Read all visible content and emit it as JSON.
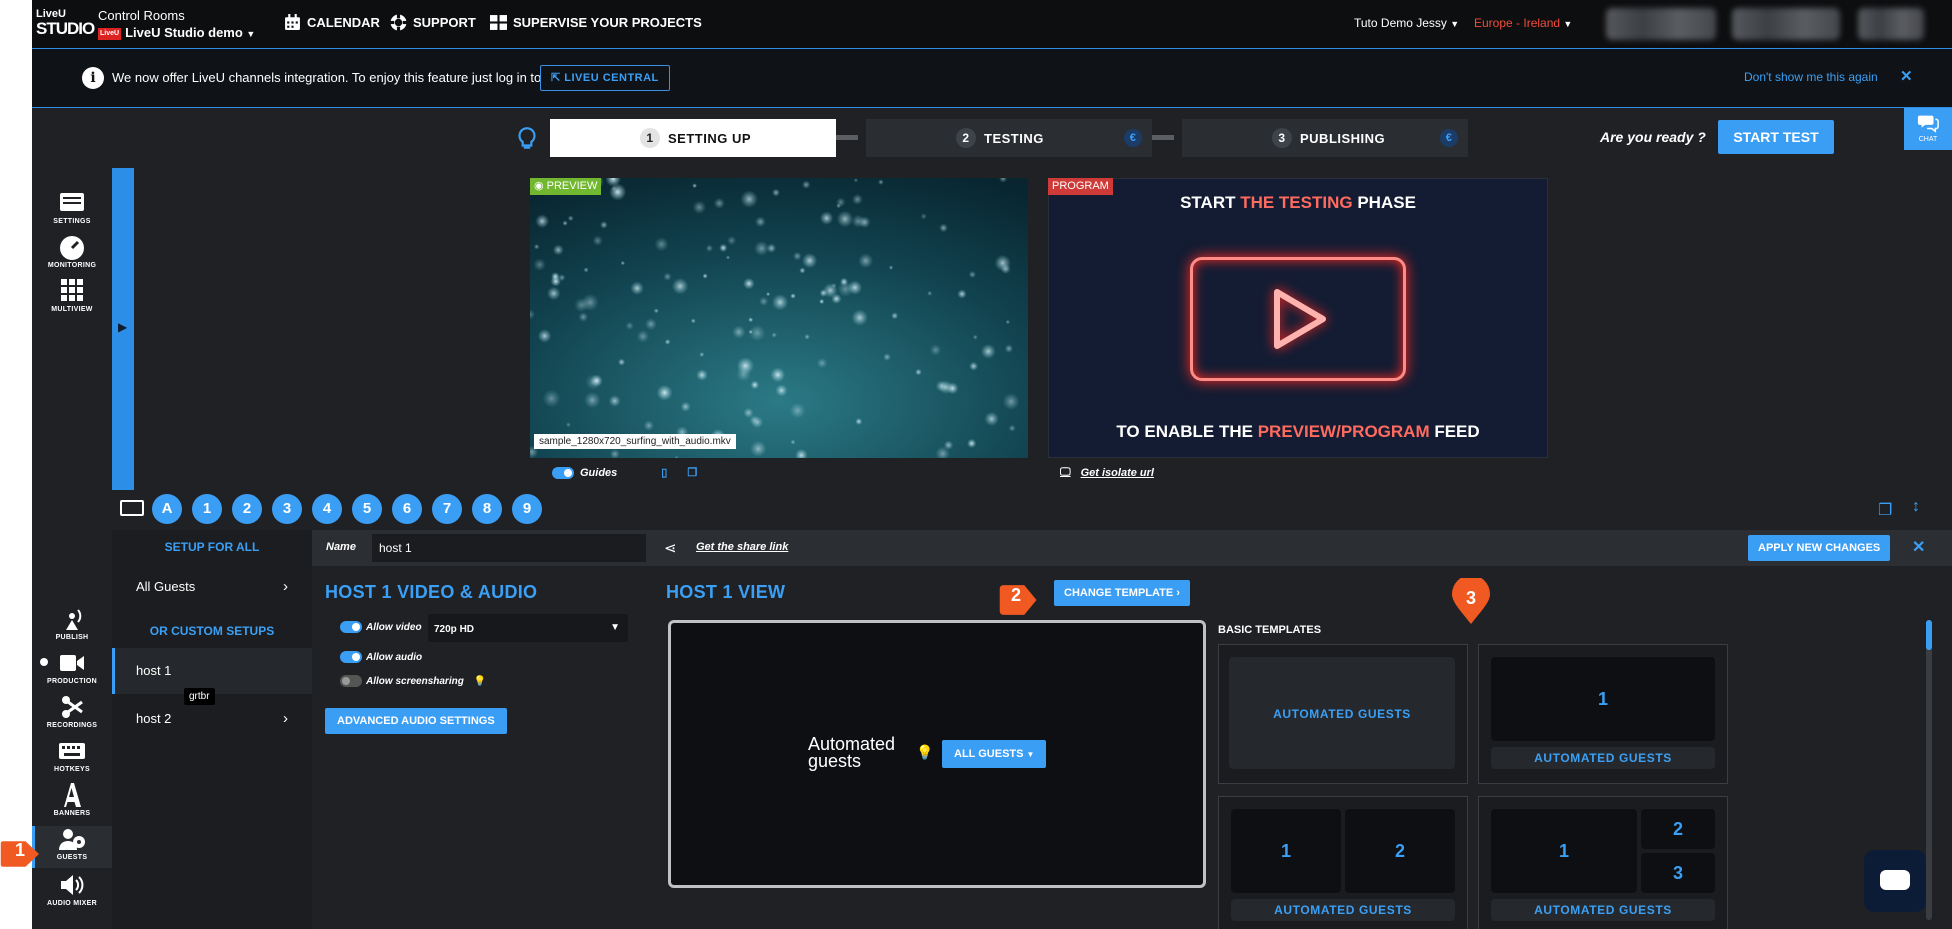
{
  "app": {
    "logo_top": "LiveU",
    "logo_bottom": "STUDIO",
    "rooms_title": "Control Rooms",
    "studio_name": "LiveU Studio demo",
    "mini_badge": "LiveU"
  },
  "nav": {
    "calendar": "CALENDAR",
    "support": "SUPPORT",
    "supervise": "SUPERVISE YOUR PROJECTS",
    "user": "Tuto Demo Jessy",
    "region": "Europe - Ireland"
  },
  "banner": {
    "text": "We now offer LiveU channels integration. To enjoy this feature just log in to",
    "button": "LIVEU CENTRAL",
    "dismiss": "Don't show me this again",
    "close": "✕"
  },
  "steps": [
    {
      "num": "1",
      "label": "SETTING UP"
    },
    {
      "num": "2",
      "label": "TESTING"
    },
    {
      "num": "3",
      "label": "PUBLISHING"
    }
  ],
  "euro": "€",
  "ready": "Are you ready ?",
  "start_test": "START TEST",
  "chat": "CHAT",
  "left_nav": {
    "settings": "SETTINGS",
    "monitoring": "MONITORING",
    "multiview": "MULTIVIEW",
    "publish": "PUBLISH",
    "production": "PRODUCTION",
    "recordings": "RECORDINGS",
    "hotkeys": "HOTKEYS",
    "banners": "BANNERS",
    "guests": "GUESTS",
    "audio_mixer": "AUDIO MIXER"
  },
  "preview": {
    "label": "PREVIEW",
    "filename": "sample_1280x720_surfing_with_audio.mkv",
    "guides": "Guides"
  },
  "program": {
    "label": "PROGRAM",
    "title_a": "START ",
    "title_b": "THE TESTING",
    "title_c": " PHASE",
    "bottom_a": "TO ENABLE THE ",
    "bottom_b": "PREVIEW/PROGRAM",
    "bottom_c": " FEED",
    "isolate": "Get isolate url"
  },
  "hotkeys": [
    "A",
    "1",
    "2",
    "3",
    "4",
    "5",
    "6",
    "7",
    "8",
    "9"
  ],
  "setup": {
    "for_all": "SETUP FOR ALL",
    "all_guests": "All Guests",
    "custom": "OR CUSTOM SETUPS",
    "host1": "host 1",
    "host2": "host 2",
    "tooltip": "grtbr"
  },
  "name_bar": {
    "label": "Name",
    "value": "host 1",
    "share": "Get the share link",
    "apply": "APPLY NEW CHANGES",
    "close": "✕"
  },
  "video_audio": {
    "title": "HOST 1 VIDEO & AUDIO",
    "allow_video": "Allow video",
    "quality": "720p HD",
    "allow_audio": "Allow audio",
    "allow_screen": "Allow screensharing",
    "advanced": "ADVANCED AUDIO SETTINGS"
  },
  "view": {
    "title": "HOST 1 VIEW",
    "change_template": "CHANGE TEMPLATE",
    "automated_line1": "Automated",
    "automated_line2": "guests",
    "all_guests_btn": "ALL GUESTS"
  },
  "templates": {
    "heading": "BASIC TEMPLATES",
    "card_label": "AUTOMATED GUESTS",
    "cells": {
      "one": "1",
      "two": "2",
      "three": "3"
    }
  },
  "callouts": [
    "1",
    "2",
    "3"
  ],
  "colors": {
    "accent": "#3b9ef5",
    "region": "#f44b3a",
    "callout": "#f05a22",
    "preview_badge": "#71b730",
    "program_badge": "#ce3a37"
  }
}
